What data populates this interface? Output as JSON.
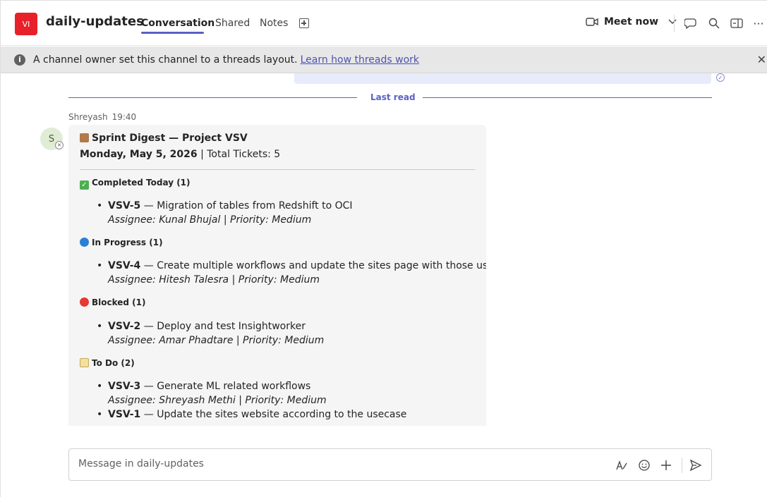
{
  "header": {
    "avatar_initials": "VI",
    "channel_title": "daily-updates",
    "tabs": [
      {
        "label": "Conversation",
        "active": true
      },
      {
        "label": "Shared",
        "active": false
      },
      {
        "label": "Notes",
        "active": false
      }
    ],
    "meet_label": "Meet now"
  },
  "banner": {
    "text": "A channel owner set this channel to a threads layout.",
    "link": "Learn how threads work"
  },
  "divider": {
    "label": "Last read"
  },
  "message": {
    "sender": "Shreyash",
    "time": "19:40",
    "avatar_initial": "S",
    "title": "Sprint Digest — Project VSV",
    "date": "Monday, May 5, 2026",
    "date_suffix": " | Total Tickets: 5",
    "sections": [
      {
        "heading": "Completed Today (1)",
        "items": [
          {
            "id": "VSV-5",
            "text": " — Migration of tables from Redshift to OCI",
            "meta": "Assignee: Kunal Bhujal | Priority: Medium"
          }
        ]
      },
      {
        "heading": "In Progress (1)",
        "items": [
          {
            "id": "VSV-4",
            "text": " — Create multiple workflows and update the sites page with those usecase",
            "meta": "Assignee: Hitesh Talesra | Priority: Medium"
          }
        ]
      },
      {
        "heading": "Blocked (1)",
        "items": [
          {
            "id": "VSV-2",
            "text": " — Deploy and test Insightworker",
            "meta": "Assignee: Amar Phadtare | Priority: Medium"
          }
        ]
      },
      {
        "heading": "To Do (2)",
        "items": [
          {
            "id": "VSV-3",
            "text": " — Generate ML related workflows",
            "meta": "Assignee: Shreyash Methi | Priority: Medium"
          },
          {
            "id": "VSV-1",
            "text": " — Update the sites website according to the usecase",
            "meta": ""
          }
        ]
      }
    ]
  },
  "compose": {
    "placeholder": "Message in daily-updates"
  },
  "colors": {
    "accent": "#5b5fc7",
    "brand_avatar": "#e8202a",
    "banner_bg": "#e7e7e7",
    "bubble_bg": "#f5f5f5"
  }
}
